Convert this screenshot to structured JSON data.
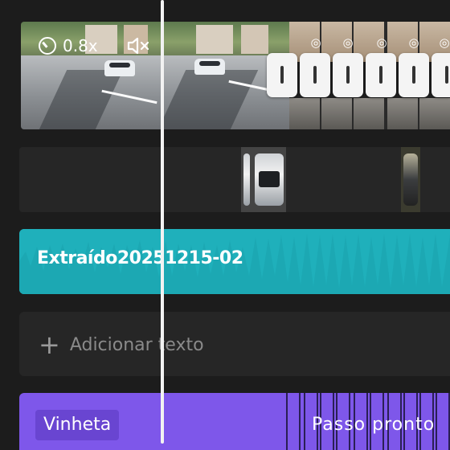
{
  "video_track": {
    "speed_label": "0.8x",
    "speed_icon": "speed-gauge-icon",
    "mute_icon": "speaker-muted-icon",
    "transition_icon": "transition-icon"
  },
  "audio_track": {
    "clip_name": "Extraído20251215-02",
    "color": "#1fb0bb"
  },
  "text_track": {
    "add_label": "Adicionar texto",
    "add_icon": "plus-icon"
  },
  "effect_track": {
    "first_effect": "Vinheta",
    "second_effect": "Passo pronto",
    "color": "#7e57ea"
  },
  "playhead": {
    "color": "#f2f2f2"
  }
}
